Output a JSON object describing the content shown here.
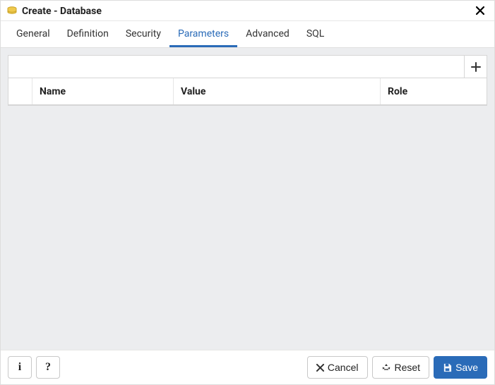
{
  "window": {
    "title": "Create - Database"
  },
  "tabs": [
    {
      "label": "General",
      "active": false
    },
    {
      "label": "Definition",
      "active": false
    },
    {
      "label": "Security",
      "active": false
    },
    {
      "label": "Parameters",
      "active": true
    },
    {
      "label": "Advanced",
      "active": false
    },
    {
      "label": "SQL",
      "active": false
    }
  ],
  "parameters": {
    "columns": {
      "name": "Name",
      "value": "Value",
      "role": "Role"
    },
    "rows": []
  },
  "footer": {
    "cancel": "Cancel",
    "reset": "Reset",
    "save": "Save"
  }
}
